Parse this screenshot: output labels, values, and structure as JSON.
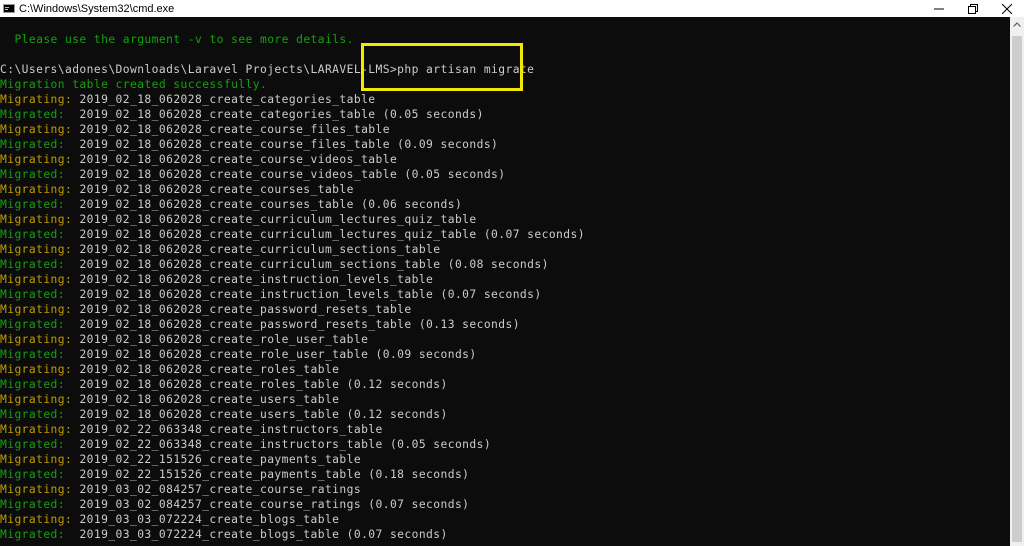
{
  "window": {
    "title": "C:\\Windows\\System32\\cmd.exe",
    "controls": {
      "minimize": "minimize-icon",
      "restore": "restore-icon",
      "close": "close-icon"
    }
  },
  "colors": {
    "background": "#0c0c0c",
    "text_default": "#cccccc",
    "text_green": "#13a10e",
    "text_yellow": "#c19c00",
    "highlight": "#f3e900"
  },
  "console": {
    "lines": [
      {
        "segments": [
          {
            "text": "  Please use the argument ",
            "color": "green"
          },
          {
            "text": "-v",
            "color": "green"
          },
          {
            "text": " to see more details.",
            "color": "green"
          }
        ]
      },
      {
        "segments": [
          {
            "text": "",
            "color": "white"
          }
        ]
      },
      {
        "segments": [
          {
            "text": "C:\\Users\\adones\\Downloads\\Laravel Projects\\LARAVEL-LMS>php artisan migrate",
            "color": "white"
          }
        ]
      },
      {
        "segments": [
          {
            "text": "Migration table created successfully.",
            "color": "green"
          }
        ]
      },
      {
        "segments": [
          {
            "text": "Migrating: ",
            "color": "yellow"
          },
          {
            "text": "2019_02_18_062028_create_categories_table",
            "color": "white"
          }
        ]
      },
      {
        "segments": [
          {
            "text": "Migrated:  ",
            "color": "green"
          },
          {
            "text": "2019_02_18_062028_create_categories_table (0.05 seconds)",
            "color": "white"
          }
        ]
      },
      {
        "segments": [
          {
            "text": "Migrating: ",
            "color": "yellow"
          },
          {
            "text": "2019_02_18_062028_create_course_files_table",
            "color": "white"
          }
        ]
      },
      {
        "segments": [
          {
            "text": "Migrated:  ",
            "color": "green"
          },
          {
            "text": "2019_02_18_062028_create_course_files_table (0.09 seconds)",
            "color": "white"
          }
        ]
      },
      {
        "segments": [
          {
            "text": "Migrating: ",
            "color": "yellow"
          },
          {
            "text": "2019_02_18_062028_create_course_videos_table",
            "color": "white"
          }
        ]
      },
      {
        "segments": [
          {
            "text": "Migrated:  ",
            "color": "green"
          },
          {
            "text": "2019_02_18_062028_create_course_videos_table (0.05 seconds)",
            "color": "white"
          }
        ]
      },
      {
        "segments": [
          {
            "text": "Migrating: ",
            "color": "yellow"
          },
          {
            "text": "2019_02_18_062028_create_courses_table",
            "color": "white"
          }
        ]
      },
      {
        "segments": [
          {
            "text": "Migrated:  ",
            "color": "green"
          },
          {
            "text": "2019_02_18_062028_create_courses_table (0.06 seconds)",
            "color": "white"
          }
        ]
      },
      {
        "segments": [
          {
            "text": "Migrating: ",
            "color": "yellow"
          },
          {
            "text": "2019_02_18_062028_create_curriculum_lectures_quiz_table",
            "color": "white"
          }
        ]
      },
      {
        "segments": [
          {
            "text": "Migrated:  ",
            "color": "green"
          },
          {
            "text": "2019_02_18_062028_create_curriculum_lectures_quiz_table (0.07 seconds)",
            "color": "white"
          }
        ]
      },
      {
        "segments": [
          {
            "text": "Migrating: ",
            "color": "yellow"
          },
          {
            "text": "2019_02_18_062028_create_curriculum_sections_table",
            "color": "white"
          }
        ]
      },
      {
        "segments": [
          {
            "text": "Migrated:  ",
            "color": "green"
          },
          {
            "text": "2019_02_18_062028_create_curriculum_sections_table (0.08 seconds)",
            "color": "white"
          }
        ]
      },
      {
        "segments": [
          {
            "text": "Migrating: ",
            "color": "yellow"
          },
          {
            "text": "2019_02_18_062028_create_instruction_levels_table",
            "color": "white"
          }
        ]
      },
      {
        "segments": [
          {
            "text": "Migrated:  ",
            "color": "green"
          },
          {
            "text": "2019_02_18_062028_create_instruction_levels_table (0.07 seconds)",
            "color": "white"
          }
        ]
      },
      {
        "segments": [
          {
            "text": "Migrating: ",
            "color": "yellow"
          },
          {
            "text": "2019_02_18_062028_create_password_resets_table",
            "color": "white"
          }
        ]
      },
      {
        "segments": [
          {
            "text": "Migrated:  ",
            "color": "green"
          },
          {
            "text": "2019_02_18_062028_create_password_resets_table (0.13 seconds)",
            "color": "white"
          }
        ]
      },
      {
        "segments": [
          {
            "text": "Migrating: ",
            "color": "yellow"
          },
          {
            "text": "2019_02_18_062028_create_role_user_table",
            "color": "white"
          }
        ]
      },
      {
        "segments": [
          {
            "text": "Migrated:  ",
            "color": "green"
          },
          {
            "text": "2019_02_18_062028_create_role_user_table (0.09 seconds)",
            "color": "white"
          }
        ]
      },
      {
        "segments": [
          {
            "text": "Migrating: ",
            "color": "yellow"
          },
          {
            "text": "2019_02_18_062028_create_roles_table",
            "color": "white"
          }
        ]
      },
      {
        "segments": [
          {
            "text": "Migrated:  ",
            "color": "green"
          },
          {
            "text": "2019_02_18_062028_create_roles_table (0.12 seconds)",
            "color": "white"
          }
        ]
      },
      {
        "segments": [
          {
            "text": "Migrating: ",
            "color": "yellow"
          },
          {
            "text": "2019_02_18_062028_create_users_table",
            "color": "white"
          }
        ]
      },
      {
        "segments": [
          {
            "text": "Migrated:  ",
            "color": "green"
          },
          {
            "text": "2019_02_18_062028_create_users_table (0.12 seconds)",
            "color": "white"
          }
        ]
      },
      {
        "segments": [
          {
            "text": "Migrating: ",
            "color": "yellow"
          },
          {
            "text": "2019_02_22_063348_create_instructors_table",
            "color": "white"
          }
        ]
      },
      {
        "segments": [
          {
            "text": "Migrated:  ",
            "color": "green"
          },
          {
            "text": "2019_02_22_063348_create_instructors_table (0.05 seconds)",
            "color": "white"
          }
        ]
      },
      {
        "segments": [
          {
            "text": "Migrating: ",
            "color": "yellow"
          },
          {
            "text": "2019_02_22_151526_create_payments_table",
            "color": "white"
          }
        ]
      },
      {
        "segments": [
          {
            "text": "Migrated:  ",
            "color": "green"
          },
          {
            "text": "2019_02_22_151526_create_payments_table (0.18 seconds)",
            "color": "white"
          }
        ]
      },
      {
        "segments": [
          {
            "text": "Migrating: ",
            "color": "yellow"
          },
          {
            "text": "2019_03_02_084257_create_course_ratings",
            "color": "white"
          }
        ]
      },
      {
        "segments": [
          {
            "text": "Migrated:  ",
            "color": "green"
          },
          {
            "text": "2019_03_02_084257_create_course_ratings (0.07 seconds)",
            "color": "white"
          }
        ]
      },
      {
        "segments": [
          {
            "text": "Migrating: ",
            "color": "yellow"
          },
          {
            "text": "2019_03_03_072224_create_blogs_table",
            "color": "white"
          }
        ]
      },
      {
        "segments": [
          {
            "text": "Migrated:  ",
            "color": "green"
          },
          {
            "text": "2019_03_03_072224_create_blogs_table (0.07 seconds)",
            "color": "white"
          }
        ]
      }
    ]
  }
}
